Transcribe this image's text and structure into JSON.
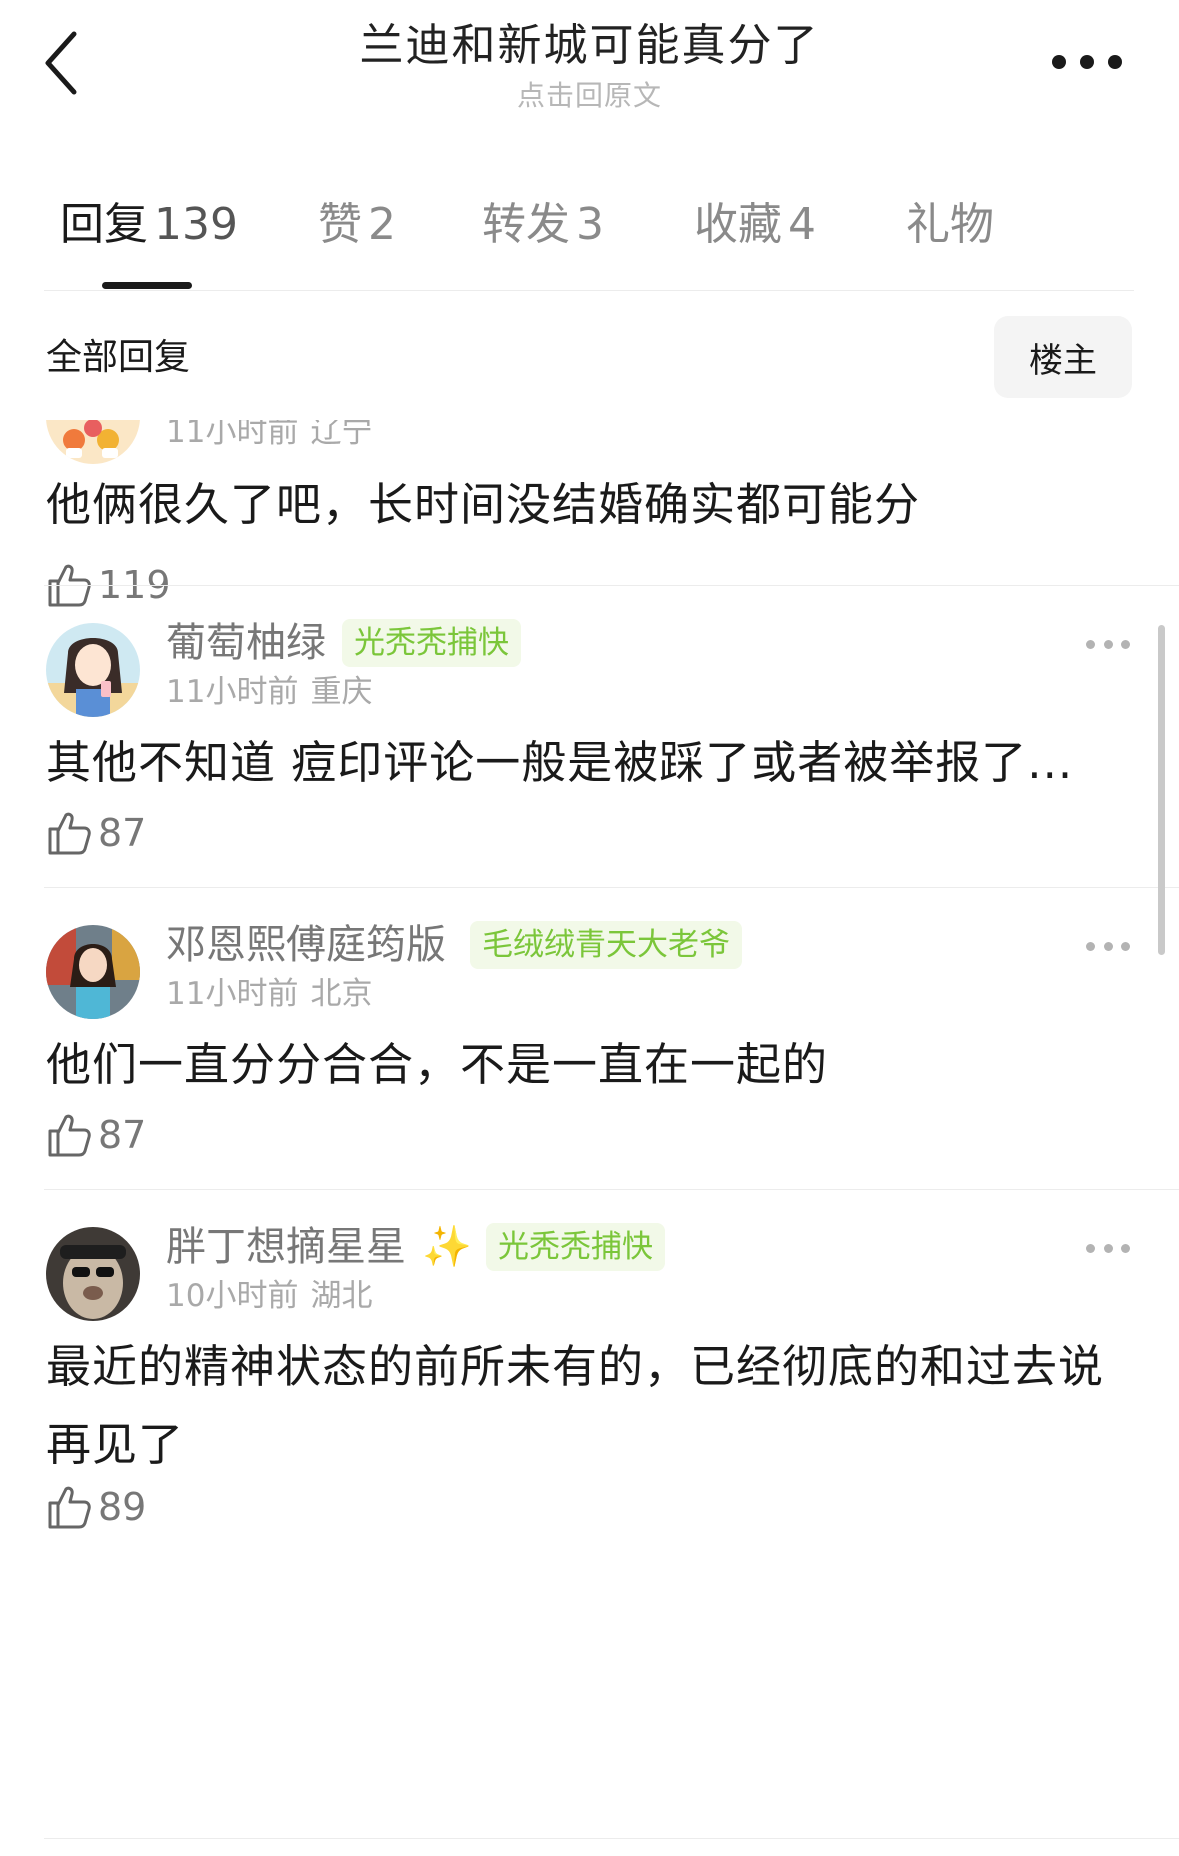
{
  "header": {
    "title": "兰迪和新城可能真分了",
    "subtitle": "点击回原文"
  },
  "tabs": [
    {
      "label": "回复",
      "count": "139",
      "active": true
    },
    {
      "label": "赞",
      "count": "2",
      "active": false
    },
    {
      "label": "转发",
      "count": "3",
      "active": false
    },
    {
      "label": "收藏",
      "count": "4",
      "active": false
    },
    {
      "label": "礼物",
      "count": "",
      "active": false
    }
  ],
  "section": {
    "title": "全部回复",
    "owner_filter": "楼主"
  },
  "comments": [
    {
      "username": "",
      "badge": "",
      "time": "11小时前",
      "location": "辽宁",
      "content": "他俩很久了吧，长时间没结婚确实都可能分",
      "likes": "119"
    },
    {
      "username": "葡萄柚绿",
      "badge": "光秃秃捕快",
      "time": "11小时前",
      "location": "重庆",
      "content": "其他不知道 痘印评论一般是被踩了或者被举报了...",
      "likes": "87"
    },
    {
      "username": "邓恩熙傅庭筠版",
      "badge": "毛绒绒青天大老爷",
      "time": "11小时前",
      "location": "北京",
      "content": "他们一直分分合合，不是一直在一起的",
      "likes": "87"
    },
    {
      "username": "胖丁想摘星星",
      "badge": "光秃秃捕快",
      "time": "10小时前",
      "location": "湖北",
      "content": "最近的精神状态的前所未有的，已经彻底的和过去说再见了",
      "likes": "89"
    }
  ],
  "colors": {
    "badge_text": "#7bc63a",
    "badge_bg": "#f2f9e8",
    "meta_text": "#a9a9a9"
  },
  "icons": {
    "back": "chevron-left-icon",
    "more": "more-horizontal-icon",
    "like": "thumbs-up-icon",
    "sparkle": "sparkles-icon"
  }
}
